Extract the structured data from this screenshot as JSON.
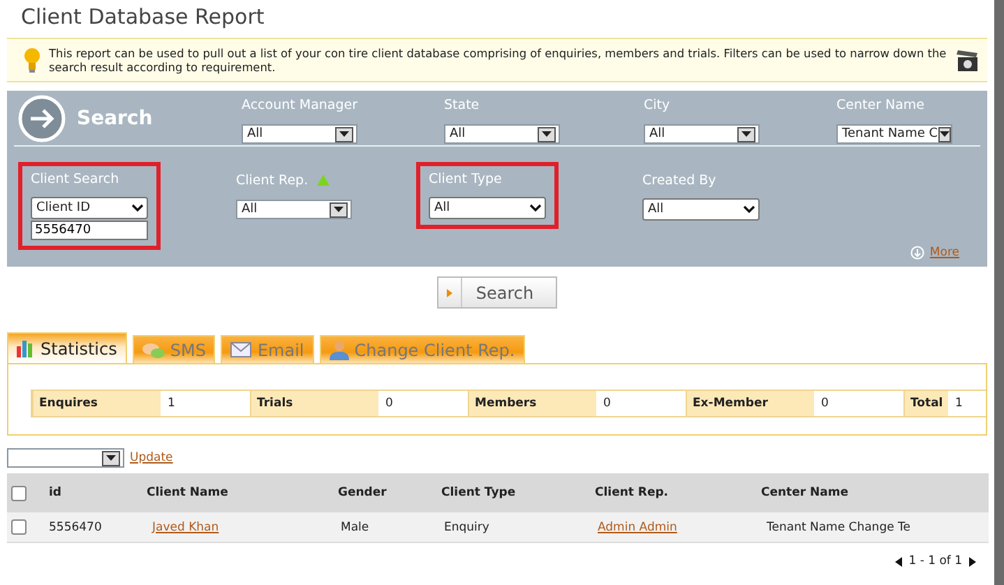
{
  "title": "Client Database Report",
  "info": "This report can be used to pull out a list of your con tire client database comprising of enquiries, members and trials. Filters can be used to narrow down the search result according to requirement.",
  "search_panel": {
    "heading": "Search",
    "row_1": [
      {
        "label": "Account Manager",
        "value": "All",
        "kind": "box",
        "highlighted": false
      },
      {
        "label": "State",
        "value": "All",
        "kind": "box",
        "highlighted": false
      },
      {
        "label": "City",
        "value": "All",
        "kind": "box",
        "highlighted": false
      },
      {
        "label": "Center Name",
        "value": "Tenant Name C",
        "kind": "box",
        "highlighted": false
      }
    ],
    "row_2": [
      {
        "label": "Client Search",
        "value": "Client ID",
        "kind": "native",
        "highlighted": true,
        "input": "5556470"
      },
      {
        "label": "Client Rep.",
        "value": "All",
        "kind": "box",
        "highlighted": false,
        "marker": true
      },
      {
        "label": "Client Type",
        "value": "All",
        "kind": "native",
        "highlighted": true
      },
      {
        "label": "Created By",
        "value": "All",
        "kind": "native",
        "highlighted": false
      }
    ],
    "more_link": "More"
  },
  "search_button": "Search",
  "tabs": [
    {
      "label": "Statistics",
      "selected": true
    },
    {
      "label": "SMS",
      "selected": false
    },
    {
      "label": "Email",
      "selected": false
    },
    {
      "label": "Change Client Rep.",
      "selected": false
    }
  ],
  "statistics": [
    {
      "label": "Enquires",
      "value": "1"
    },
    {
      "label": "Trials",
      "value": "0"
    },
    {
      "label": "Members",
      "value": "0"
    },
    {
      "label": "Ex-Member",
      "value": "0"
    },
    {
      "label": "Total",
      "value": "1"
    }
  ],
  "bulk_action": {
    "update_link": "Update"
  },
  "table": {
    "columns": [
      "id",
      "Client Name",
      "Gender",
      "Client Type",
      "Client Rep.",
      "Center Name"
    ],
    "header_checked": false,
    "rows": [
      {
        "checked": false,
        "cells": [
          "5556470",
          "Javed Khan",
          "Male",
          "Enquiry",
          "Admin Admin",
          "Tenant Name Change Te"
        ]
      }
    ]
  },
  "pager": "1 - 1 of 1"
}
